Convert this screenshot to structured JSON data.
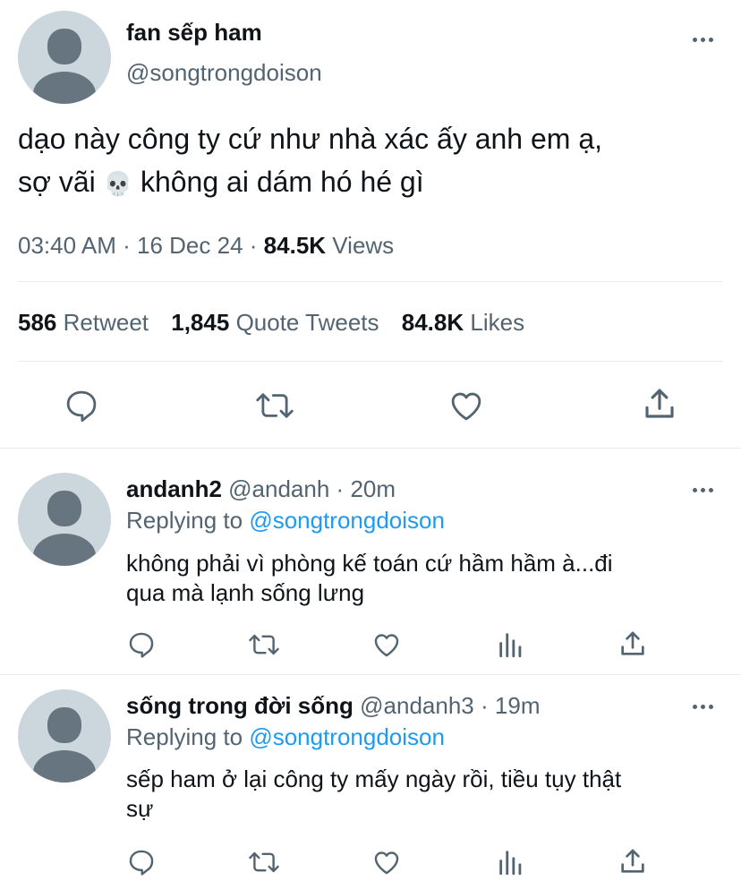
{
  "main_tweet": {
    "display_name": "fan sếp ham",
    "handle": "@songtrongdoison",
    "text_line1": "dạo này công ty cứ như nhà xác ấy anh em ạ,",
    "text_line2_before": "sợ vãi",
    "emoji": "💀",
    "text_line2_after": "không ai dám hó hé gì",
    "time": "03:40 AM",
    "date": "16 Dec 24",
    "views_count": "84.5K",
    "views_label": "Views",
    "retweets_count": "586",
    "retweets_label": "Retweet",
    "quotes_count": "1,845",
    "quotes_label": "Quote Tweets",
    "likes_count": "84.8K",
    "likes_label": "Likes",
    "sep": "·"
  },
  "replies": [
    {
      "display_name": "andanh2",
      "handle": "@andanh",
      "time": "20m",
      "replying_label": "Replying to",
      "replying_handle": "@songtrongdoison",
      "text_line1": "không phải vì phòng kế toán cứ hầm hầm à...đi",
      "text_line2": "qua mà lạnh sống lưng"
    },
    {
      "display_name": "sống trong đời sống",
      "handle": "@andanh3",
      "time": "19m",
      "replying_label": "Replying to",
      "replying_handle": "@songtrongdoison",
      "text_line1": "sếp ham ở lại công ty mấy ngày rồi, tiều tụy thật",
      "text_line2": "sự"
    }
  ],
  "colors": {
    "accent": "#1d9bf0",
    "secondary_text": "#536471",
    "avatar_bg": "#ccd6dd",
    "avatar_fg": "#66757f"
  }
}
